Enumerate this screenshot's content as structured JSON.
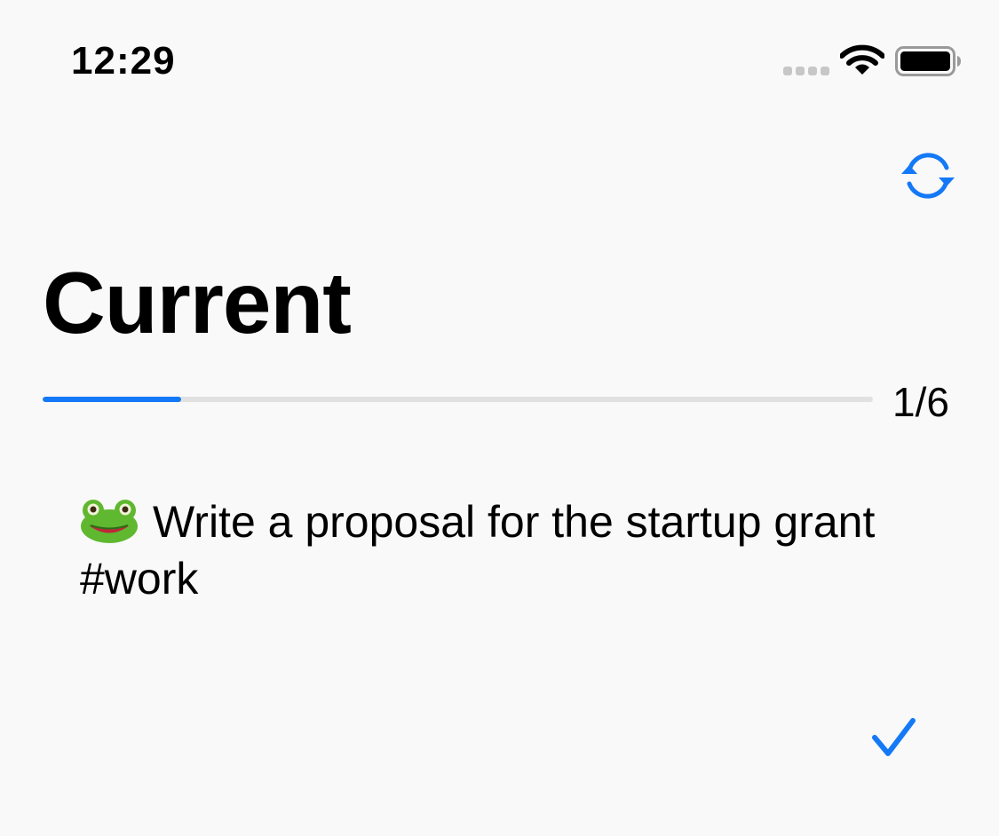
{
  "status_bar": {
    "time": "12:29",
    "signal_icon": "cellular-signal-icon",
    "wifi_icon": "wifi-icon",
    "battery_icon": "battery-icon"
  },
  "nav": {
    "refresh_icon": "refresh-icon"
  },
  "header": {
    "title": "Current"
  },
  "progress": {
    "current": 1,
    "total": 6,
    "label": "1/6",
    "fraction": 0.1667
  },
  "task": {
    "emoji_icon": "frog-icon",
    "line1": "Write a proposal for the startup grant",
    "line2": "#work"
  },
  "actions": {
    "complete_icon": "checkmark-icon"
  },
  "colors": {
    "accent": "#1479f6",
    "track": "#e1e1e1",
    "background": "#f9f9f9"
  }
}
